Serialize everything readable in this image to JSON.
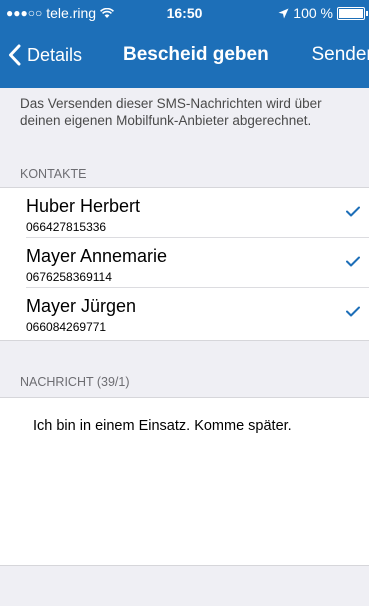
{
  "status_bar": {
    "carrier": "tele.ring",
    "time": "16:50",
    "battery": "100 %"
  },
  "nav": {
    "back_label": "Details",
    "title": "Bescheid geben",
    "send_label": "Senden"
  },
  "notice": "Das Versenden dieser SMS-Nachrichten wird über deinen eigenen Mobilfunk-Anbieter abgerechnet.",
  "contacts_header": "KONTAKTE",
  "contacts": [
    {
      "name": "Huber Herbert",
      "phone": "066427815336",
      "selected": true
    },
    {
      "name": "Mayer Annemarie",
      "phone": "0676258369114",
      "selected": true
    },
    {
      "name": "Mayer Jürgen",
      "phone": "066084269771",
      "selected": true
    }
  ],
  "message_header": "NACHRICHT (39/1)",
  "message_text": "Ich bin in einem Einsatz. Komme später.",
  "colors": {
    "accent": "#1d6fb8",
    "check": "#1d6fb8",
    "background": "#efeff4"
  }
}
